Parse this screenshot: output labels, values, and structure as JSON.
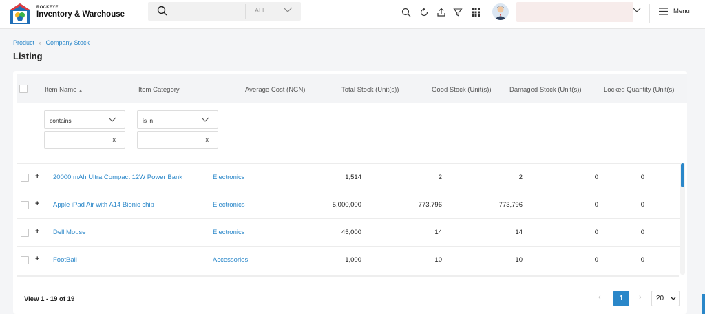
{
  "header": {
    "brand_small": "ROCKEYE",
    "brand_big": "Inventory & Warehouse",
    "search": {
      "placeholder": "",
      "scope": "ALL"
    },
    "menu_label": "Menu",
    "user_name": ""
  },
  "breadcrumb": {
    "items": [
      "Product",
      "Company Stock"
    ],
    "separator": "»"
  },
  "page_title": "Listing",
  "table": {
    "columns": [
      "Item Name",
      "Item Category",
      "Average Cost (NGN)",
      "Total Stock (Unit(s))",
      "Good Stock (Unit(s))",
      "Damaged Stock (Unit(s))",
      "Locked Quantity (Unit(s)"
    ],
    "sort_indicator": "▲",
    "filters": {
      "name_operator": "contains",
      "category_operator": "is in",
      "clear": "x"
    },
    "rows": [
      {
        "name": "20000 mAh Ultra Compact 12W Power Bank",
        "category": "Electronics",
        "avg_cost": "1,514",
        "total": "2",
        "good": "2",
        "damaged": "0",
        "locked": "0"
      },
      {
        "name": "Apple iPad Air with A14 Bionic chip",
        "category": "Electronics",
        "avg_cost": "5,000,000",
        "total": "773,796",
        "good": "773,796",
        "damaged": "0",
        "locked": "0"
      },
      {
        "name": "Dell Mouse",
        "category": "Electronics",
        "avg_cost": "45,000",
        "total": "14",
        "good": "14",
        "damaged": "0",
        "locked": "0"
      },
      {
        "name": "FootBall",
        "category": "Accessories",
        "avg_cost": "1,000",
        "total": "10",
        "good": "10",
        "damaged": "0",
        "locked": "0"
      }
    ]
  },
  "pagination": {
    "view_text": "View 1 - 19 of 19",
    "current_page": "1",
    "prev": "‹",
    "next": "›",
    "page_size": "20"
  },
  "colors": {
    "accent": "#2a87c9",
    "brand_red": "#e03a3e",
    "brand_blue": "#1f6fb8",
    "brand_yellow": "#f3b52b",
    "brand_green": "#3bb54a"
  }
}
